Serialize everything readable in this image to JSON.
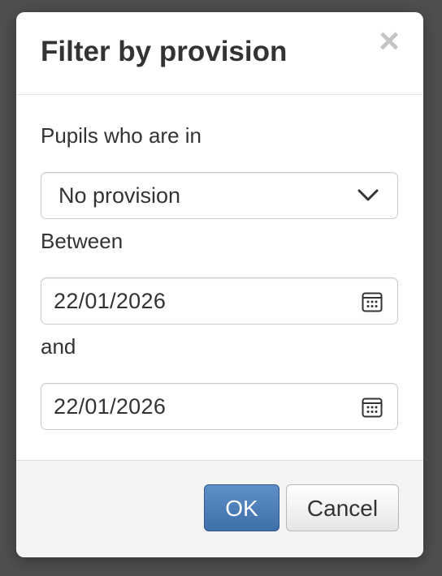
{
  "dialog": {
    "title": "Filter by provision",
    "close_icon": "close-icon"
  },
  "form": {
    "pupils_label": "Pupils who are in",
    "provision_selected": "No provision",
    "between_label": "Between",
    "start_date": "22/01/2026",
    "and_label": "and",
    "end_date": "22/01/2026"
  },
  "footer": {
    "ok_label": "OK",
    "cancel_label": "Cancel"
  },
  "colors": {
    "backdrop": "#4f4f4f",
    "primary_button": "#4a7ab5",
    "close_icon": "#c4c4c4"
  }
}
